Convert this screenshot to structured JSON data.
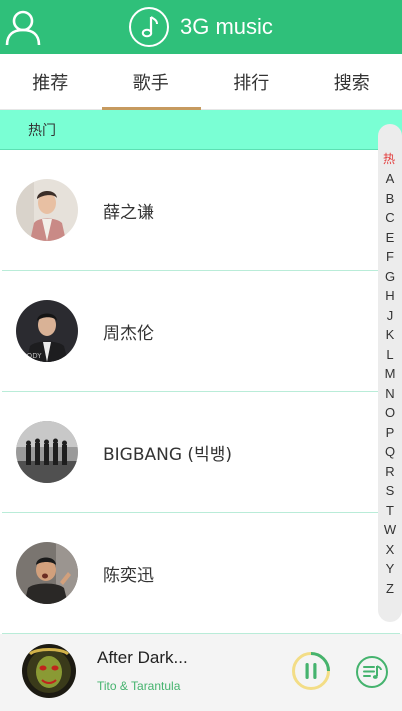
{
  "header": {
    "title": "3G music",
    "user_icon": "user-icon",
    "logo_icon": "music-note-icon",
    "bg_color": "#2fc07a"
  },
  "tabs": [
    {
      "label": "推荐",
      "active": false
    },
    {
      "label": "歌手",
      "active": true
    },
    {
      "label": "排行",
      "active": false
    },
    {
      "label": "搜索",
      "active": false
    }
  ],
  "section": {
    "label": "热门"
  },
  "artists": [
    {
      "name": "薛之谦"
    },
    {
      "name": "周杰伦"
    },
    {
      "name": "BIGBANG (빅뱅)"
    },
    {
      "name": "陈奕迅"
    }
  ],
  "index_bar": {
    "hot": "热",
    "letters": [
      "A",
      "B",
      "C",
      "E",
      "F",
      "G",
      "H",
      "J",
      "K",
      "L",
      "M",
      "N",
      "O",
      "P",
      "Q",
      "R",
      "S",
      "T",
      "W",
      "X",
      "Y",
      "Z"
    ]
  },
  "player": {
    "title": "After Dark...",
    "artist": "Tito & Tarantula",
    "pause_icon": "pause-icon",
    "playlist_icon": "playlist-icon",
    "accent": "#45b36e"
  }
}
